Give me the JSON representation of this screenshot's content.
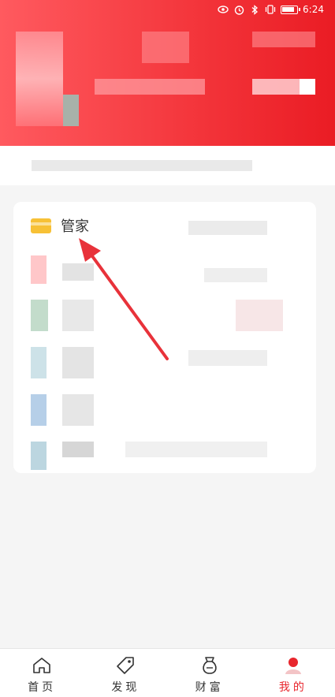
{
  "status_bar": {
    "time": "6:24"
  },
  "card": {
    "title": "管家"
  },
  "bottom_nav": {
    "items": [
      {
        "label": "首页",
        "icon": "home-icon",
        "active": false
      },
      {
        "label": "发现",
        "icon": "tag-icon",
        "active": false
      },
      {
        "label": "财富",
        "icon": "money-bag-icon",
        "active": false
      },
      {
        "label": "我的",
        "icon": "profile-icon",
        "active": true
      }
    ]
  },
  "colors": {
    "header_red": "#f3343a",
    "accent_red": "#e8262d",
    "card_icon_yellow": "#f7c136",
    "arrow_red": "#e8323a"
  }
}
